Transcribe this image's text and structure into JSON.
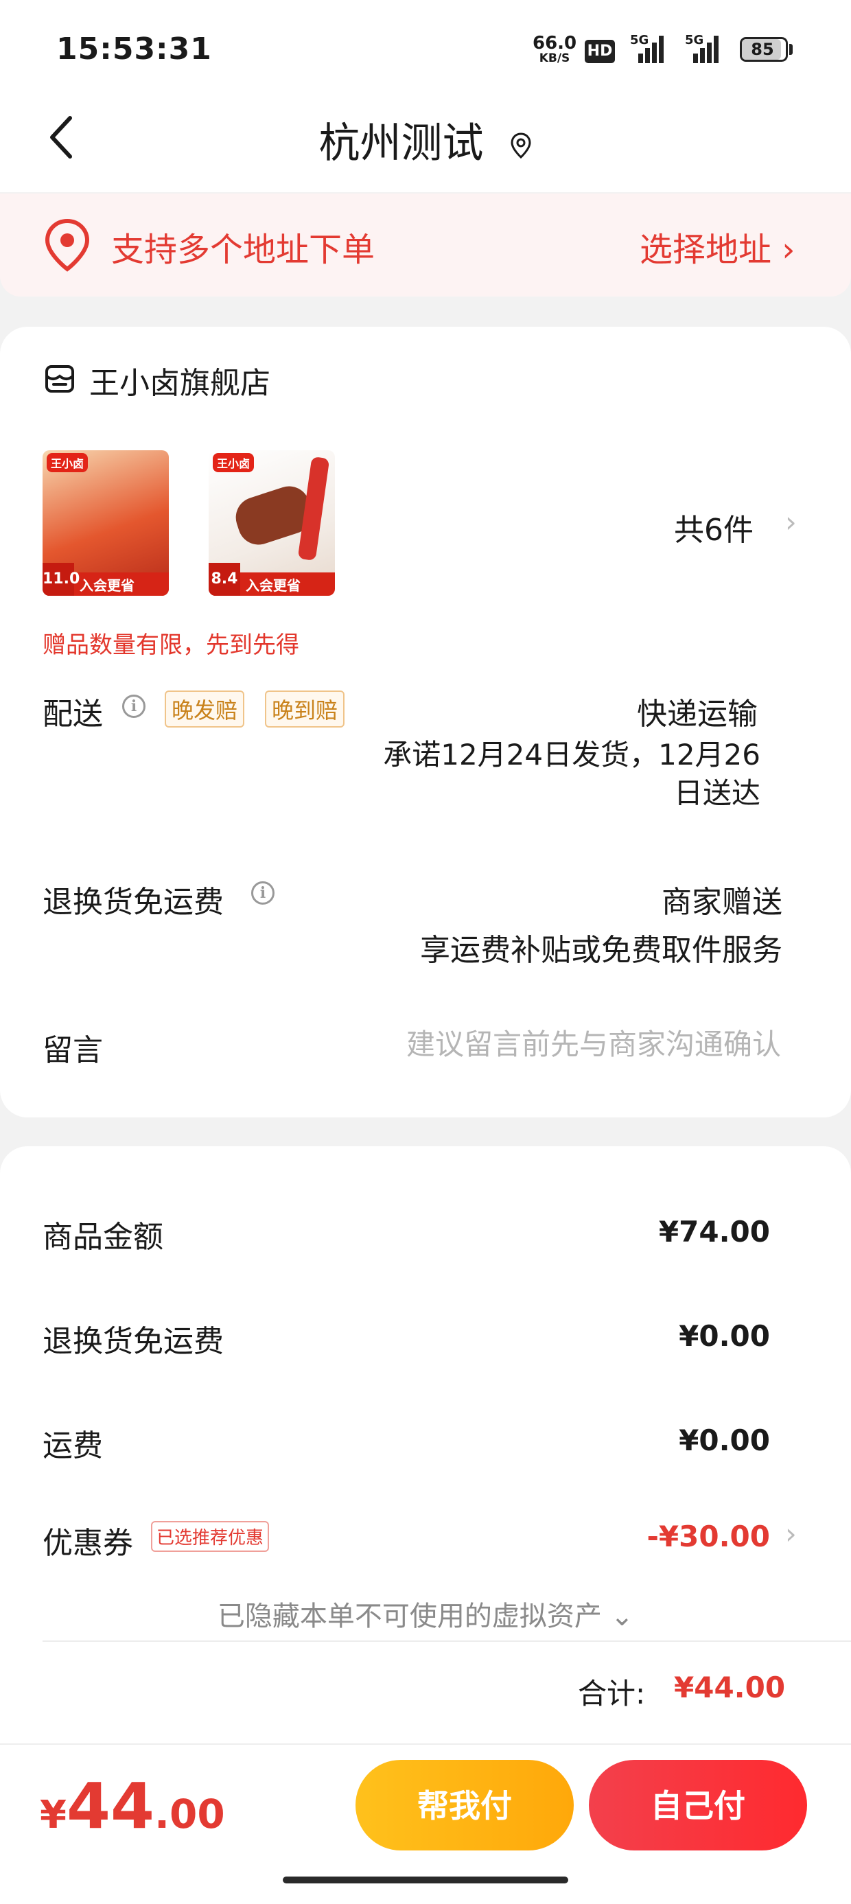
{
  "status_bar": {
    "time": "15:53:31",
    "net_speed_value": "66.0",
    "net_speed_unit": "KB/S",
    "hd_label": "HD",
    "sim1_label": "5G",
    "sim2_label": "5G",
    "battery": "85"
  },
  "nav": {
    "title": "杭州测试",
    "back_icon": "chevron-left-icon",
    "location_icon": "location-pin-icon"
  },
  "address_banner": {
    "text": "支持多个地址下单",
    "action": "选择地址 ›",
    "icon": "location-pin-icon"
  },
  "store": {
    "name": "王小卤旗舰店",
    "products": [
      {
        "brand": "王小卤",
        "price": "11.0",
        "promo": "入会更省"
      },
      {
        "brand": "王小卤",
        "price": "8.4",
        "promo": "入会更省"
      }
    ],
    "item_count": "共6件",
    "gift_note": "赠品数量有限，先到先得"
  },
  "delivery": {
    "label": "配送",
    "tag_late_ship": "晚发赔",
    "tag_late_arrive": "晚到赔",
    "method": "快递运输",
    "promise_line1": "承诺12月24日发货，12月26",
    "promise_line2": "日送达"
  },
  "return_fee": {
    "label": "退换货免运费",
    "value": "商家赠送",
    "desc": "享运费补贴或免费取件服务"
  },
  "message": {
    "label": "留言",
    "placeholder": "建议留言前先与商家沟通确认"
  },
  "summary": {
    "goods_label": "商品金额",
    "goods_value": "¥74.00",
    "return_fee_label": "退换货免运费",
    "return_fee_value": "¥0.00",
    "shipping_label": "运费",
    "shipping_value": "¥0.00",
    "coupon_label": "优惠券",
    "coupon_tag": "已选推荐优惠",
    "coupon_value": "-¥30.00",
    "hidden_assets": "已隐藏本单不可使用的虚拟资产 ⌄",
    "total_label": "合计:",
    "total_value": "¥44.00"
  },
  "bottom": {
    "currency": "¥",
    "price_int": "44",
    "price_dec": ".00",
    "help_pay": "帮我付",
    "self_pay": "自己付"
  },
  "colors": {
    "accent_red": "#e33a32",
    "pay_yellow": "#ffb914",
    "pay_red": "#f3404c",
    "tag_orange": "#c9821b"
  }
}
